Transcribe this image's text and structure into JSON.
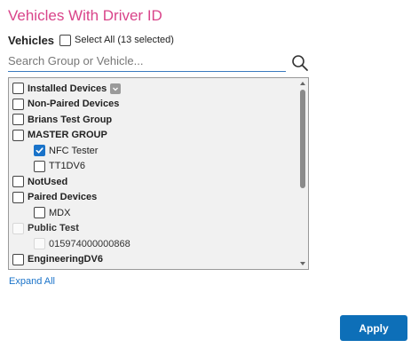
{
  "title": "Vehicles With Driver ID",
  "vehicles": {
    "label": "Vehicles",
    "select_all_label": "Select All (13 selected)"
  },
  "search": {
    "placeholder": "Search Group or Vehicle...",
    "value": ""
  },
  "tree": {
    "items": [
      {
        "label": "Installed Devices",
        "group": true,
        "checked": false,
        "disabled": false,
        "badge": "info-icon"
      },
      {
        "label": "Non-Paired Devices",
        "group": true,
        "checked": false,
        "disabled": false
      },
      {
        "label": "Brians Test Group",
        "group": true,
        "checked": false,
        "disabled": false
      },
      {
        "label": "MASTER GROUP",
        "group": true,
        "checked": false,
        "disabled": false
      },
      {
        "label": "NFC Tester",
        "group": false,
        "checked": true,
        "disabled": false
      },
      {
        "label": "TT1DV6",
        "group": false,
        "checked": false,
        "disabled": false
      },
      {
        "label": "NotUsed",
        "group": true,
        "checked": false,
        "disabled": false
      },
      {
        "label": "Paired Devices",
        "group": true,
        "checked": false,
        "disabled": false
      },
      {
        "label": "MDX",
        "group": false,
        "checked": false,
        "disabled": false
      },
      {
        "label": "Public Test",
        "group": true,
        "checked": false,
        "disabled": true
      },
      {
        "label": "015974000000868",
        "group": false,
        "checked": false,
        "disabled": true
      },
      {
        "label": "EngineeringDV6",
        "group": true,
        "checked": false,
        "disabled": false
      }
    ]
  },
  "expand_all_label": "Expand All",
  "apply_label": "Apply",
  "colors": {
    "title": "#d9448a",
    "accent": "#1a73c9",
    "apply_bg": "#0d6fb8"
  }
}
